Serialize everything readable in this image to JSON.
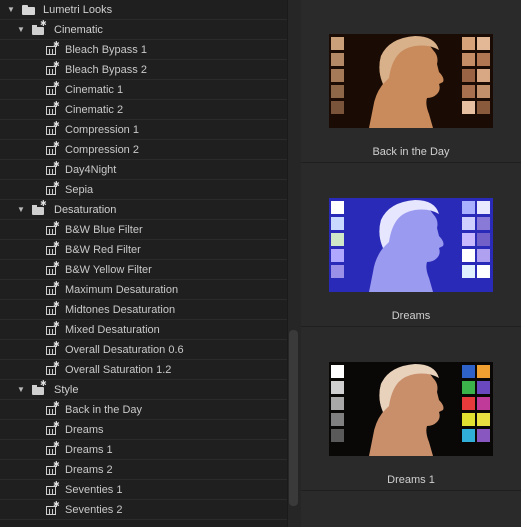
{
  "tree": {
    "root": {
      "label": "Lumetri Looks"
    },
    "folders": [
      {
        "label": "Cinematic",
        "items": [
          "Bleach Bypass 1",
          "Bleach Bypass 2",
          "Cinematic 1",
          "Cinematic 2",
          "Compression 1",
          "Compression 2",
          "Day4Night",
          "Sepia"
        ]
      },
      {
        "label": "Desaturation",
        "items": [
          "B&W Blue Filter",
          "B&W Red Filter",
          "B&W Yellow Filter",
          "Maximum Desaturation",
          "Midtones Desaturation",
          "Mixed Desaturation",
          "Overall Desaturation 0.6",
          "Overall Saturation 1.2"
        ]
      },
      {
        "label": "Style",
        "items": [
          "Back in the Day",
          "Dreams",
          "Dreams 1",
          "Dreams 2",
          "Seventies 1",
          "Seventies 2"
        ]
      }
    ]
  },
  "previews": [
    {
      "label": "Back in the Day",
      "bg": "#1a0c04",
      "face": "#c98a5c",
      "hair": "#d8b08a",
      "left": [
        "#caa07a",
        "#b48a66",
        "#a57a58",
        "#8e6648",
        "#7a543a"
      ],
      "right": [
        "#d6a27a",
        "#e2b896",
        "#c48d66",
        "#b07752",
        "#9a6444",
        "#d8a884",
        "#a8704e",
        "#c2906a",
        "#e6c0a0",
        "#8a5a3c"
      ]
    },
    {
      "label": "Dreams",
      "bg": "#2a2ab8",
      "face": "#9a9af0",
      "hair": "#e6e6ff",
      "left": [
        "#ffffff",
        "#c8d8ff",
        "#cfe8c8",
        "#b0a8ff",
        "#9a90e8"
      ],
      "right": [
        "#a8b0ff",
        "#e8e8ff",
        "#d0d0ff",
        "#8a7ad8",
        "#c8b8ff",
        "#7060c8",
        "#ffffff",
        "#b0a0f0",
        "#e0f0ff",
        "#ffffff"
      ]
    },
    {
      "label": "Dreams 1",
      "bg": "#0a0807",
      "face": "#c98f6a",
      "hair": "#e8d2bc",
      "left": [
        "#ffffff",
        "#d0d0d0",
        "#a8a8a8",
        "#808080",
        "#5a5a5a"
      ],
      "right": [
        "#2f62c8",
        "#f0a030",
        "#3cb24a",
        "#6a48c0",
        "#e83a3a",
        "#c03a9a",
        "#e0e030",
        "#e8e040",
        "#30b0d8",
        "#8858c0"
      ]
    }
  ]
}
